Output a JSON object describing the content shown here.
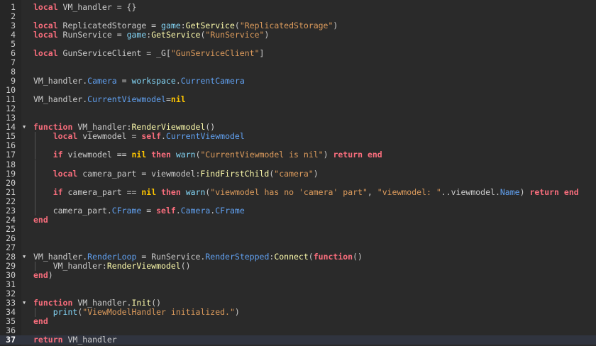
{
  "editor": {
    "current_line": 37,
    "fold_lines": [
      14,
      28,
      33
    ],
    "guide_lines": [
      15,
      16,
      17,
      18,
      19,
      20,
      21,
      22,
      23,
      29,
      34
    ],
    "colors": {
      "keyword": "#f86d7c",
      "nil": "#ffc600",
      "method": "#fdfbac",
      "property": "#61a1f1",
      "string": "#dc9b5c",
      "builtin": "#84d6f7",
      "text": "#cccccc"
    },
    "lines": [
      [
        [
          "kw",
          "local"
        ],
        [
          "txt",
          " VM_handler = {}"
        ]
      ],
      [],
      [
        [
          "kw",
          "local"
        ],
        [
          "txt",
          " ReplicatedStorage = "
        ],
        [
          "builtin",
          "game"
        ],
        [
          "txt",
          ":"
        ],
        [
          "method",
          "GetService"
        ],
        [
          "txt",
          "("
        ],
        [
          "str",
          "\"ReplicatedStorage\""
        ],
        [
          "txt",
          ")"
        ]
      ],
      [
        [
          "kw",
          "local"
        ],
        [
          "txt",
          " RunService = "
        ],
        [
          "builtin",
          "game"
        ],
        [
          "txt",
          ":"
        ],
        [
          "method",
          "GetService"
        ],
        [
          "txt",
          "("
        ],
        [
          "str",
          "\"RunService\""
        ],
        [
          "txt",
          ")"
        ]
      ],
      [],
      [
        [
          "kw",
          "local"
        ],
        [
          "txt",
          " GunServiceClient = _G["
        ],
        [
          "str",
          "\"GunServiceClient\""
        ],
        [
          "txt",
          "]"
        ]
      ],
      [],
      [],
      [
        [
          "txt",
          "VM_handler."
        ],
        [
          "prop",
          "Camera"
        ],
        [
          "txt",
          " = "
        ],
        [
          "builtin",
          "workspace"
        ],
        [
          "txt",
          "."
        ],
        [
          "prop",
          "CurrentCamera"
        ]
      ],
      [],
      [
        [
          "txt",
          "VM_handler."
        ],
        [
          "prop",
          "CurrentViewmodel"
        ],
        [
          "txt",
          "="
        ],
        [
          "nil",
          "nil"
        ]
      ],
      [],
      [],
      [
        [
          "kw",
          "function"
        ],
        [
          "txt",
          " VM_handler:"
        ],
        [
          "method",
          "RenderViewmodel"
        ],
        [
          "txt",
          "()"
        ]
      ],
      [
        [
          "txt",
          "    "
        ],
        [
          "kw",
          "local"
        ],
        [
          "txt",
          " viewmodel = "
        ],
        [
          "kw",
          "self"
        ],
        [
          "txt",
          "."
        ],
        [
          "prop",
          "CurrentViewmodel"
        ]
      ],
      [],
      [
        [
          "txt",
          "    "
        ],
        [
          "kw",
          "if"
        ],
        [
          "txt",
          " viewmodel == "
        ],
        [
          "nil",
          "nil"
        ],
        [
          "txt",
          " "
        ],
        [
          "kw",
          "then"
        ],
        [
          "txt",
          " "
        ],
        [
          "builtin",
          "warn"
        ],
        [
          "txt",
          "("
        ],
        [
          "str",
          "\"CurrentViewmodel is nil\""
        ],
        [
          "txt",
          ") "
        ],
        [
          "kw",
          "return"
        ],
        [
          "txt",
          " "
        ],
        [
          "kw",
          "end"
        ]
      ],
      [],
      [
        [
          "txt",
          "    "
        ],
        [
          "kw",
          "local"
        ],
        [
          "txt",
          " camera_part = viewmodel:"
        ],
        [
          "method",
          "FindFirstChild"
        ],
        [
          "txt",
          "("
        ],
        [
          "str",
          "\"camera\""
        ],
        [
          "txt",
          ")"
        ]
      ],
      [],
      [
        [
          "txt",
          "    "
        ],
        [
          "kw",
          "if"
        ],
        [
          "txt",
          " camera_part == "
        ],
        [
          "nil",
          "nil"
        ],
        [
          "txt",
          " "
        ],
        [
          "kw",
          "then"
        ],
        [
          "txt",
          " "
        ],
        [
          "builtin",
          "warn"
        ],
        [
          "txt",
          "("
        ],
        [
          "str",
          "\"viewmodel has no 'camera' part\""
        ],
        [
          "txt",
          ", "
        ],
        [
          "str",
          "\"viewmodel: \""
        ],
        [
          "txt",
          "..viewmodel."
        ],
        [
          "prop",
          "Name"
        ],
        [
          "txt",
          ") "
        ],
        [
          "kw",
          "return"
        ],
        [
          "txt",
          " "
        ],
        [
          "kw",
          "end"
        ]
      ],
      [],
      [
        [
          "txt",
          "    camera_part."
        ],
        [
          "prop",
          "CFrame"
        ],
        [
          "txt",
          " = "
        ],
        [
          "kw",
          "self"
        ],
        [
          "txt",
          "."
        ],
        [
          "prop",
          "Camera"
        ],
        [
          "txt",
          "."
        ],
        [
          "prop",
          "CFrame"
        ]
      ],
      [
        [
          "kw",
          "end"
        ]
      ],
      [],
      [],
      [],
      [
        [
          "txt",
          "VM_handler."
        ],
        [
          "prop",
          "RenderLoop"
        ],
        [
          "txt",
          " = RunService."
        ],
        [
          "prop",
          "RenderStepped"
        ],
        [
          "txt",
          ":"
        ],
        [
          "method",
          "Connect"
        ],
        [
          "txt",
          "("
        ],
        [
          "kw",
          "function"
        ],
        [
          "txt",
          "()"
        ]
      ],
      [
        [
          "txt",
          "    VM_handler:"
        ],
        [
          "method",
          "RenderViewmodel"
        ],
        [
          "txt",
          "()"
        ]
      ],
      [
        [
          "kw",
          "end"
        ],
        [
          "txt",
          ")"
        ]
      ],
      [],
      [],
      [
        [
          "kw",
          "function"
        ],
        [
          "txt",
          " VM_handler."
        ],
        [
          "method",
          "Init"
        ],
        [
          "txt",
          "()"
        ]
      ],
      [
        [
          "txt",
          "    "
        ],
        [
          "builtin",
          "print"
        ],
        [
          "txt",
          "("
        ],
        [
          "str",
          "\"ViewModelHandler initialized.\""
        ],
        [
          "txt",
          ")"
        ]
      ],
      [
        [
          "kw",
          "end"
        ]
      ],
      [],
      [
        [
          "kw",
          "return"
        ],
        [
          "txt",
          " VM_handler"
        ]
      ]
    ]
  }
}
